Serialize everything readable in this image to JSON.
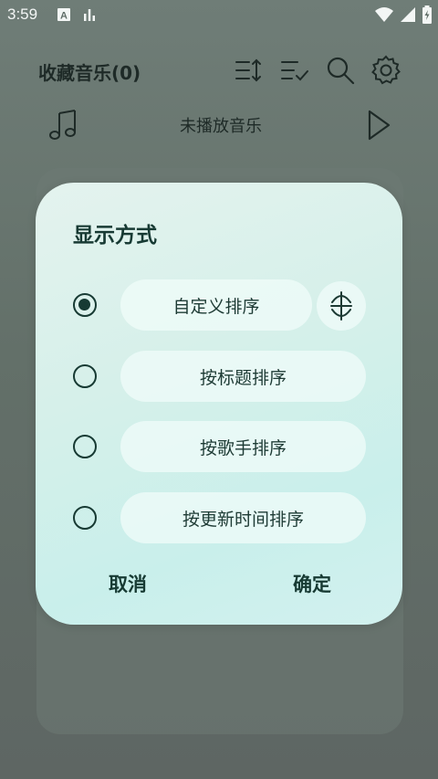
{
  "status_bar": {
    "time": "3:59",
    "left_icons": [
      "accessibility-icon",
      "equalizer-icon"
    ],
    "right_icons": [
      "wifi-icon",
      "signal-icon",
      "battery-charging-icon"
    ]
  },
  "header": {
    "title": "收藏音乐(0)",
    "icons": [
      "sort-order-icon",
      "multi-select-icon",
      "search-icon",
      "settings-icon"
    ]
  },
  "now_playing": {
    "text": "未播放音乐",
    "icons": [
      "music-note-icon",
      "play-icon"
    ]
  },
  "dialog": {
    "title": "显示方式",
    "options": [
      {
        "label": "自定义排序",
        "selected": true
      },
      {
        "label": "按标题排序",
        "selected": false
      },
      {
        "label": "按歌手排序",
        "selected": false
      },
      {
        "label": "按更新时间排序",
        "selected": false
      }
    ],
    "sort_toggle_icon": "sort-direction-icon",
    "cancel_label": "取消",
    "confirm_label": "确定"
  },
  "colors": {
    "accent": "#173a33",
    "dialog_bg": "#d6f0ea",
    "scrim": "#637069"
  }
}
